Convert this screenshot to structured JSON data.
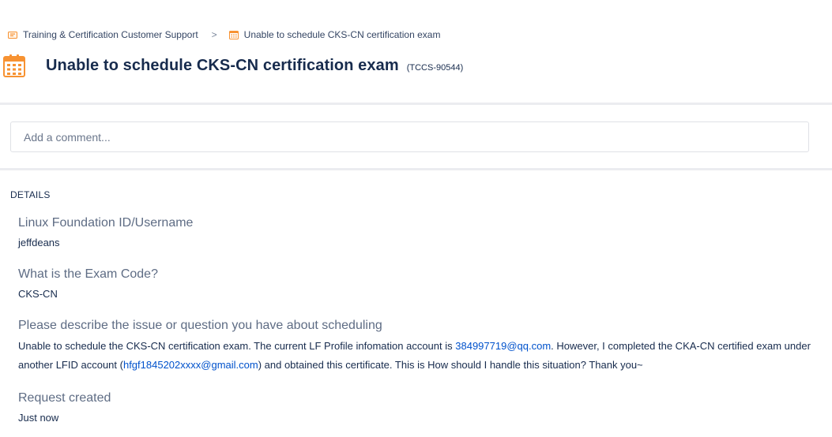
{
  "breadcrumb": {
    "project": "Training & Certification Customer Support",
    "current": "Unable to schedule CKS-CN certification exam",
    "separator": ">"
  },
  "issue": {
    "title": "Unable to schedule CKS-CN certification exam",
    "key": "(TCCS-90544)"
  },
  "comment": {
    "placeholder": "Add a comment..."
  },
  "details": {
    "heading": "DETAILS",
    "fields": [
      {
        "label": "Linux Foundation ID/Username",
        "value": "jeffdeans"
      },
      {
        "label": "What is the Exam Code?",
        "value": "CKS-CN"
      },
      {
        "label": "Please describe the issue or question you have about scheduling",
        "text1": "Unable to schedule the CKS-CN certification exam. The current LF Profile infomation account is ",
        "link1": "384997719@qq.com",
        "text2": ". However, I completed the CKA-CN certified exam under another LFID account (",
        "link2": "hfgf1845202xxxx@gmail.com",
        "text3": ") and obtained this certificate. This is How should I handle this situation? Thank you~"
      },
      {
        "label": "Request created",
        "value": "Just now"
      }
    ]
  },
  "colors": {
    "accent_orange": "#f79232",
    "link": "#0052cc",
    "text": "#172b4d",
    "muted": "#5e6c84"
  },
  "icons": {
    "project": "briefcase-icon",
    "issue": "calendar-icon"
  }
}
